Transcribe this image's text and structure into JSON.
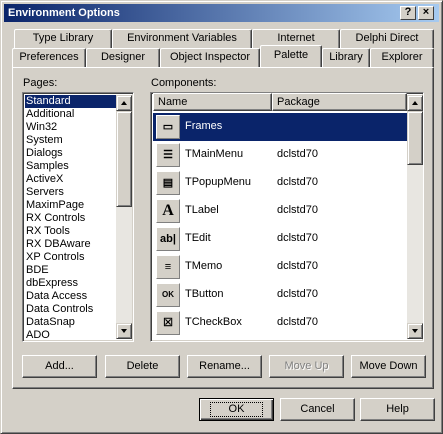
{
  "window": {
    "title": "Environment Options",
    "help_btn": "?",
    "close_btn": "×"
  },
  "tabs_back": [
    "Type Library",
    "Environment Variables",
    "Internet",
    "Delphi Direct"
  ],
  "tabs_front": [
    "Preferences",
    "Designer",
    "Object Inspector",
    "Palette",
    "Library",
    "Explorer"
  ],
  "active_tab": "Palette",
  "pages": {
    "label": "Pages:",
    "selected": "Standard",
    "items": [
      "Standard",
      "Additional",
      "Win32",
      "System",
      "Dialogs",
      "Samples",
      "ActiveX",
      "Servers",
      "MaximPage",
      "RX Controls",
      "RX Tools",
      "RX DBAware",
      "XP Controls",
      "BDE",
      "dbExpress",
      "Data Access",
      "Data Controls",
      "DataSnap",
      "ADO"
    ]
  },
  "components": {
    "label": "Components:",
    "col_name": "Name",
    "col_package": "Package",
    "rows": [
      {
        "name": "Frames",
        "package": "",
        "icon": "frames-icon",
        "glyph": "▭"
      },
      {
        "name": "TMainMenu",
        "package": "dclstd70",
        "icon": "main-menu-icon",
        "glyph": "☰"
      },
      {
        "name": "TPopupMenu",
        "package": "dclstd70",
        "icon": "popup-menu-icon",
        "glyph": "▤"
      },
      {
        "name": "TLabel",
        "package": "dclstd70",
        "icon": "label-icon",
        "glyph": "A"
      },
      {
        "name": "TEdit",
        "package": "dclstd70",
        "icon": "edit-icon",
        "glyph": "ab|"
      },
      {
        "name": "TMemo",
        "package": "dclstd70",
        "icon": "memo-icon",
        "glyph": "≡"
      },
      {
        "name": "TButton",
        "package": "dclstd70",
        "icon": "button-icon",
        "glyph": "OK"
      },
      {
        "name": "TCheckBox",
        "package": "dclstd70",
        "icon": "checkbox-icon",
        "glyph": "☒"
      }
    ]
  },
  "actions": {
    "add": "Add...",
    "delete": "Delete",
    "rename": "Rename...",
    "move_up": "Move Up",
    "move_down": "Move Down"
  },
  "footer": {
    "ok": "OK",
    "cancel": "Cancel",
    "help": "Help"
  }
}
